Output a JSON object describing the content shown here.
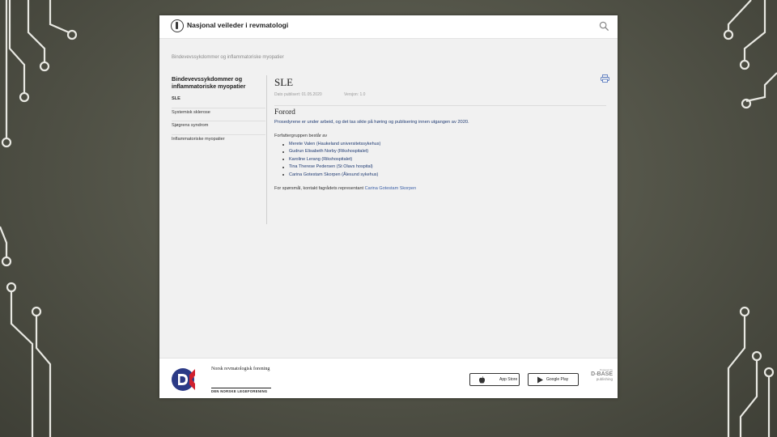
{
  "header": {
    "site_title": "Nasjonal veileder i revmatologi",
    "logo_icon": "caduceus-icon",
    "search_icon": "search-icon"
  },
  "breadcrumb": "Bindevevssykdommer og inflammatoriske myopatier",
  "sidebar": {
    "title": "Bindevevssykdommer og inflammatoriske myopatier",
    "items": [
      {
        "label": "SLE",
        "active": true
      },
      {
        "label": "Systemisk sklerose",
        "active": false
      },
      {
        "label": "Sjøgrens syndrom",
        "active": false
      },
      {
        "label": "Inflammatoriske myopatier",
        "active": false
      }
    ]
  },
  "main": {
    "title": "SLE",
    "date_published": "Dato publisert: 01.05.2020",
    "version": "Versjon: 1.0",
    "section_title": "Forord",
    "foreword_text": "Prosedyrene er under arbeid, og det tas sikte på høring og publisering innen utgangen av 2020.",
    "group_intro": "Forfattergruppen består av",
    "authors": [
      "Merete Valen (Haukeland universitetssykehus)",
      "Gudrun Elisabeth Norby (Rikshospitalet)",
      "Karoline Lerang (Rikshospitalet)",
      "Tina Therese Pedersen (St Olavs hospital)",
      "Carina Gotestam Skorpen (Ålesund sykehus)"
    ],
    "contact_text": "For spørsmål, kontakt fagrådets representant",
    "contact_link": "Carina Gotestam Skorpen",
    "print_icon": "print-icon"
  },
  "footer": {
    "org_name": "Norsk revmatologisk forening",
    "org_sub": "DEN NORSKE LEGEFORENING",
    "app_store_label": "App Store",
    "google_play_label": "Google Play",
    "dbase_small": "Powered by",
    "dbase_name": "D-BASE",
    "dbase_pub": "publishing"
  },
  "colors": {
    "link": "#1f3b73",
    "brand_blue": "#2b3a86",
    "brand_red": "#d0202e",
    "background": "#55564a"
  }
}
